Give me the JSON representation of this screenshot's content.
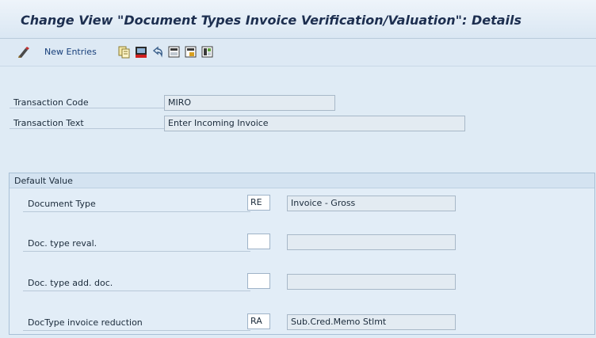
{
  "window": {
    "title": "Change View \"Document Types Invoice Verification/Valuation\": Details"
  },
  "toolbar": {
    "new_entries_label": "New Entries",
    "icons": [
      "display-change-icon",
      "copy-icon",
      "delete-icon",
      "undo-icon",
      "select-all-icon",
      "select-block-icon",
      "deselect-all-icon"
    ]
  },
  "header_fields": {
    "transaction_code": {
      "label": "Transaction Code",
      "value": "MIRO"
    },
    "transaction_text": {
      "label": "Transaction Text",
      "value": "Enter Incoming Invoice"
    }
  },
  "default_value": {
    "title": "Default Value",
    "rows": [
      {
        "label": "Document Type",
        "code": "RE",
        "description": "Invoice - Gross"
      },
      {
        "label": "Doc. type reval.",
        "code": "",
        "description": ""
      },
      {
        "label": "Doc. type add. doc.",
        "code": "",
        "description": ""
      },
      {
        "label": "DocType invoice reduction",
        "code": "RA",
        "description": "Sub.Cred.Memo Stlmt"
      }
    ]
  }
}
